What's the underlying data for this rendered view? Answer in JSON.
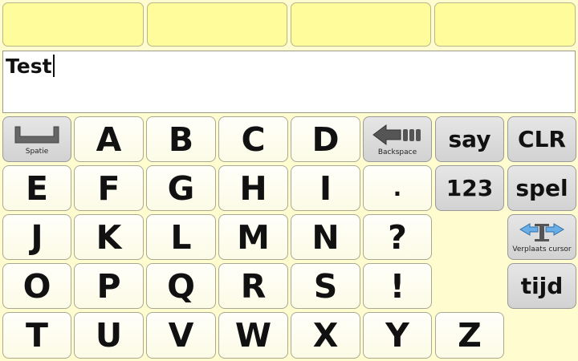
{
  "text_field": {
    "value": "Test"
  },
  "keys": {
    "space": "Spatie",
    "backspace": "Backspace",
    "say": "say",
    "clr": "CLR",
    "num": "123",
    "spel": "spel",
    "cursor": "Verplaats cursor",
    "tijd": "tijd",
    "letters": [
      "A",
      "B",
      "C",
      "D",
      "E",
      "F",
      "G",
      "H",
      "I",
      ".",
      "J",
      "K",
      "L",
      "M",
      "N",
      "?",
      "O",
      "P",
      "Q",
      "R",
      "S",
      "!",
      "T",
      "U",
      "V",
      "W",
      "X",
      "Y",
      "Z"
    ]
  },
  "icons": {
    "space": "space-bar-icon",
    "backspace": "backspace-arrow-icon",
    "cursor": "move-cursor-icon"
  },
  "colors": {
    "background": "#fffcd0",
    "prediction_slot": "#fffc9c",
    "gray_key": "#d9d9d9",
    "letter_key": "#fffffa"
  }
}
